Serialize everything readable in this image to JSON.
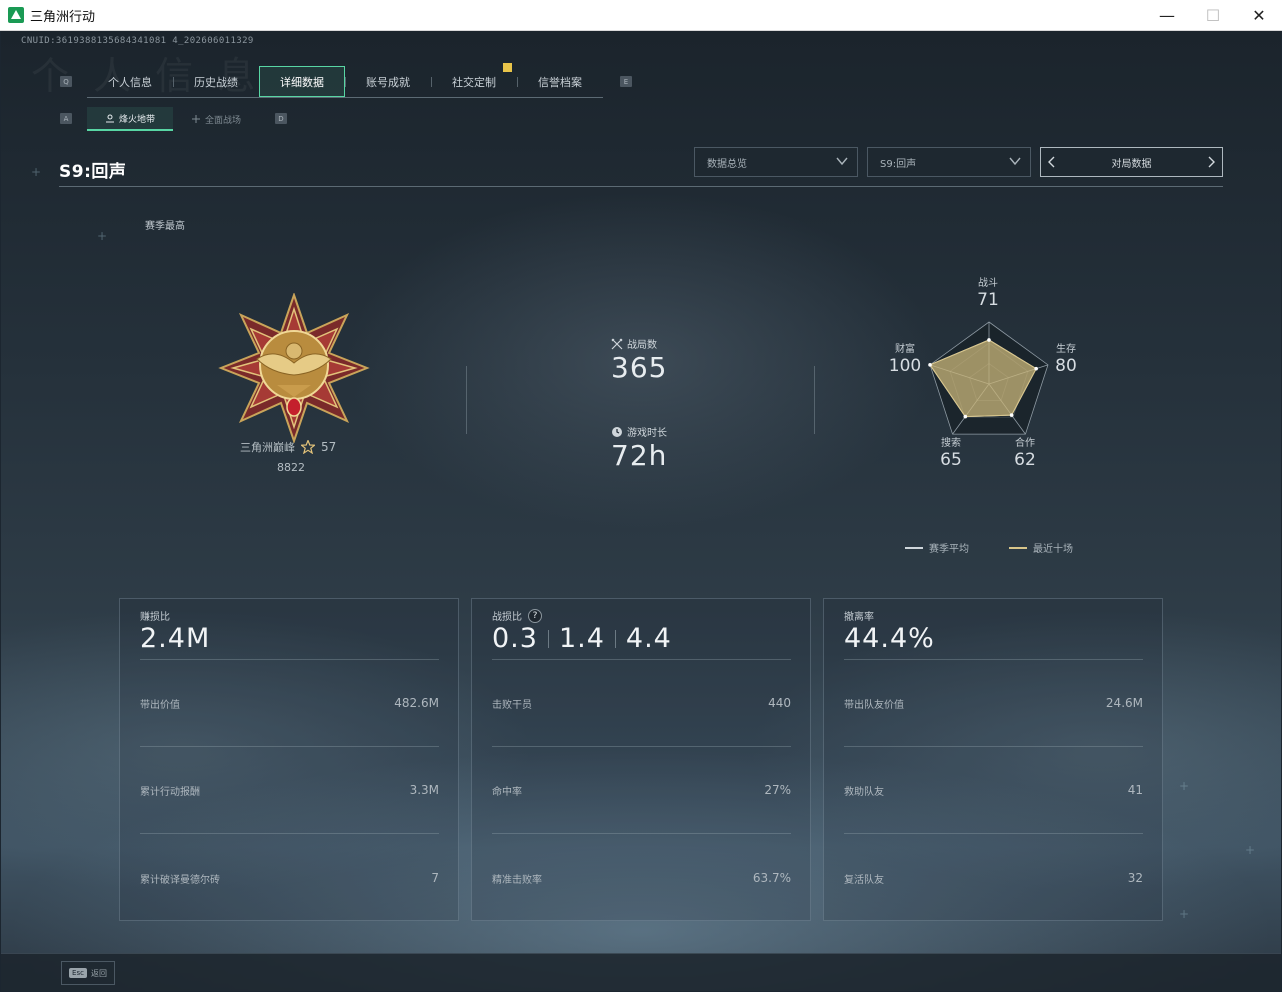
{
  "window": {
    "title": "三角洲行动",
    "minimize": "—",
    "maximize": "☐",
    "close": "✕"
  },
  "cnuid": "CNUID:3619388135684341081 4_202606011329",
  "tabs": [
    "个人信息",
    "历史战绩",
    "详细数据",
    "账号成就",
    "社交定制",
    "信誉档案"
  ],
  "active_tab": "详细数据",
  "hint_keys": {
    "prev_tab": "Q",
    "next_tab": "E",
    "prev_sub": "A",
    "next_sub": "D"
  },
  "sub_tabs": [
    "烽火地带",
    "全面战场"
  ],
  "season": {
    "title": "S9:回声",
    "dropdown1": "数据总览",
    "dropdown2": "S9:回声",
    "pager": "对局数据"
  },
  "season_best_label": "赛季最高",
  "rank": {
    "name": "三角洲巅峰",
    "level": "57",
    "score": "8822"
  },
  "stats": {
    "matches_label": "战局数",
    "matches": "365",
    "playtime_label": "游戏时长",
    "playtime": "72h"
  },
  "radar": [
    {
      "name": "战斗",
      "value": 71
    },
    {
      "name": "生存",
      "value": 80
    },
    {
      "name": "合作",
      "value": 62
    },
    {
      "name": "搜索",
      "value": 65
    },
    {
      "name": "财富",
      "value": 100
    }
  ],
  "legend": [
    {
      "label": "赛季平均",
      "color": "#cfd6db"
    },
    {
      "label": "最近十场",
      "color": "#d8c58a"
    }
  ],
  "colors": {
    "accent": "#58d6a4",
    "radar_fill": "#c9b57a",
    "notice_dot": "#e8c44a"
  },
  "cards": [
    {
      "label": "赚损比",
      "big": "2.4M",
      "rows": [
        {
          "label": "带出价值",
          "value": "482.6M"
        },
        {
          "label": "累计行动报酬",
          "value": "3.3M"
        },
        {
          "label": "累计破译曼德尔砖",
          "value": "7"
        }
      ]
    },
    {
      "label": "战损比",
      "big_parts": [
        "0.3",
        "1.4",
        "4.4"
      ],
      "rows": [
        {
          "label": "击败干员",
          "value": "440"
        },
        {
          "label": "命中率",
          "value": "27%"
        },
        {
          "label": "精准击败率",
          "value": "63.7%"
        }
      ]
    },
    {
      "label": "撤离率",
      "big": "44.4%",
      "rows": [
        {
          "label": "带出队友价值",
          "value": "24.6M"
        },
        {
          "label": "救助队友",
          "value": "41"
        },
        {
          "label": "复活队友",
          "value": "32"
        }
      ]
    }
  ],
  "bottom": {
    "esc_key": "Esc",
    "back_label": "返回"
  }
}
